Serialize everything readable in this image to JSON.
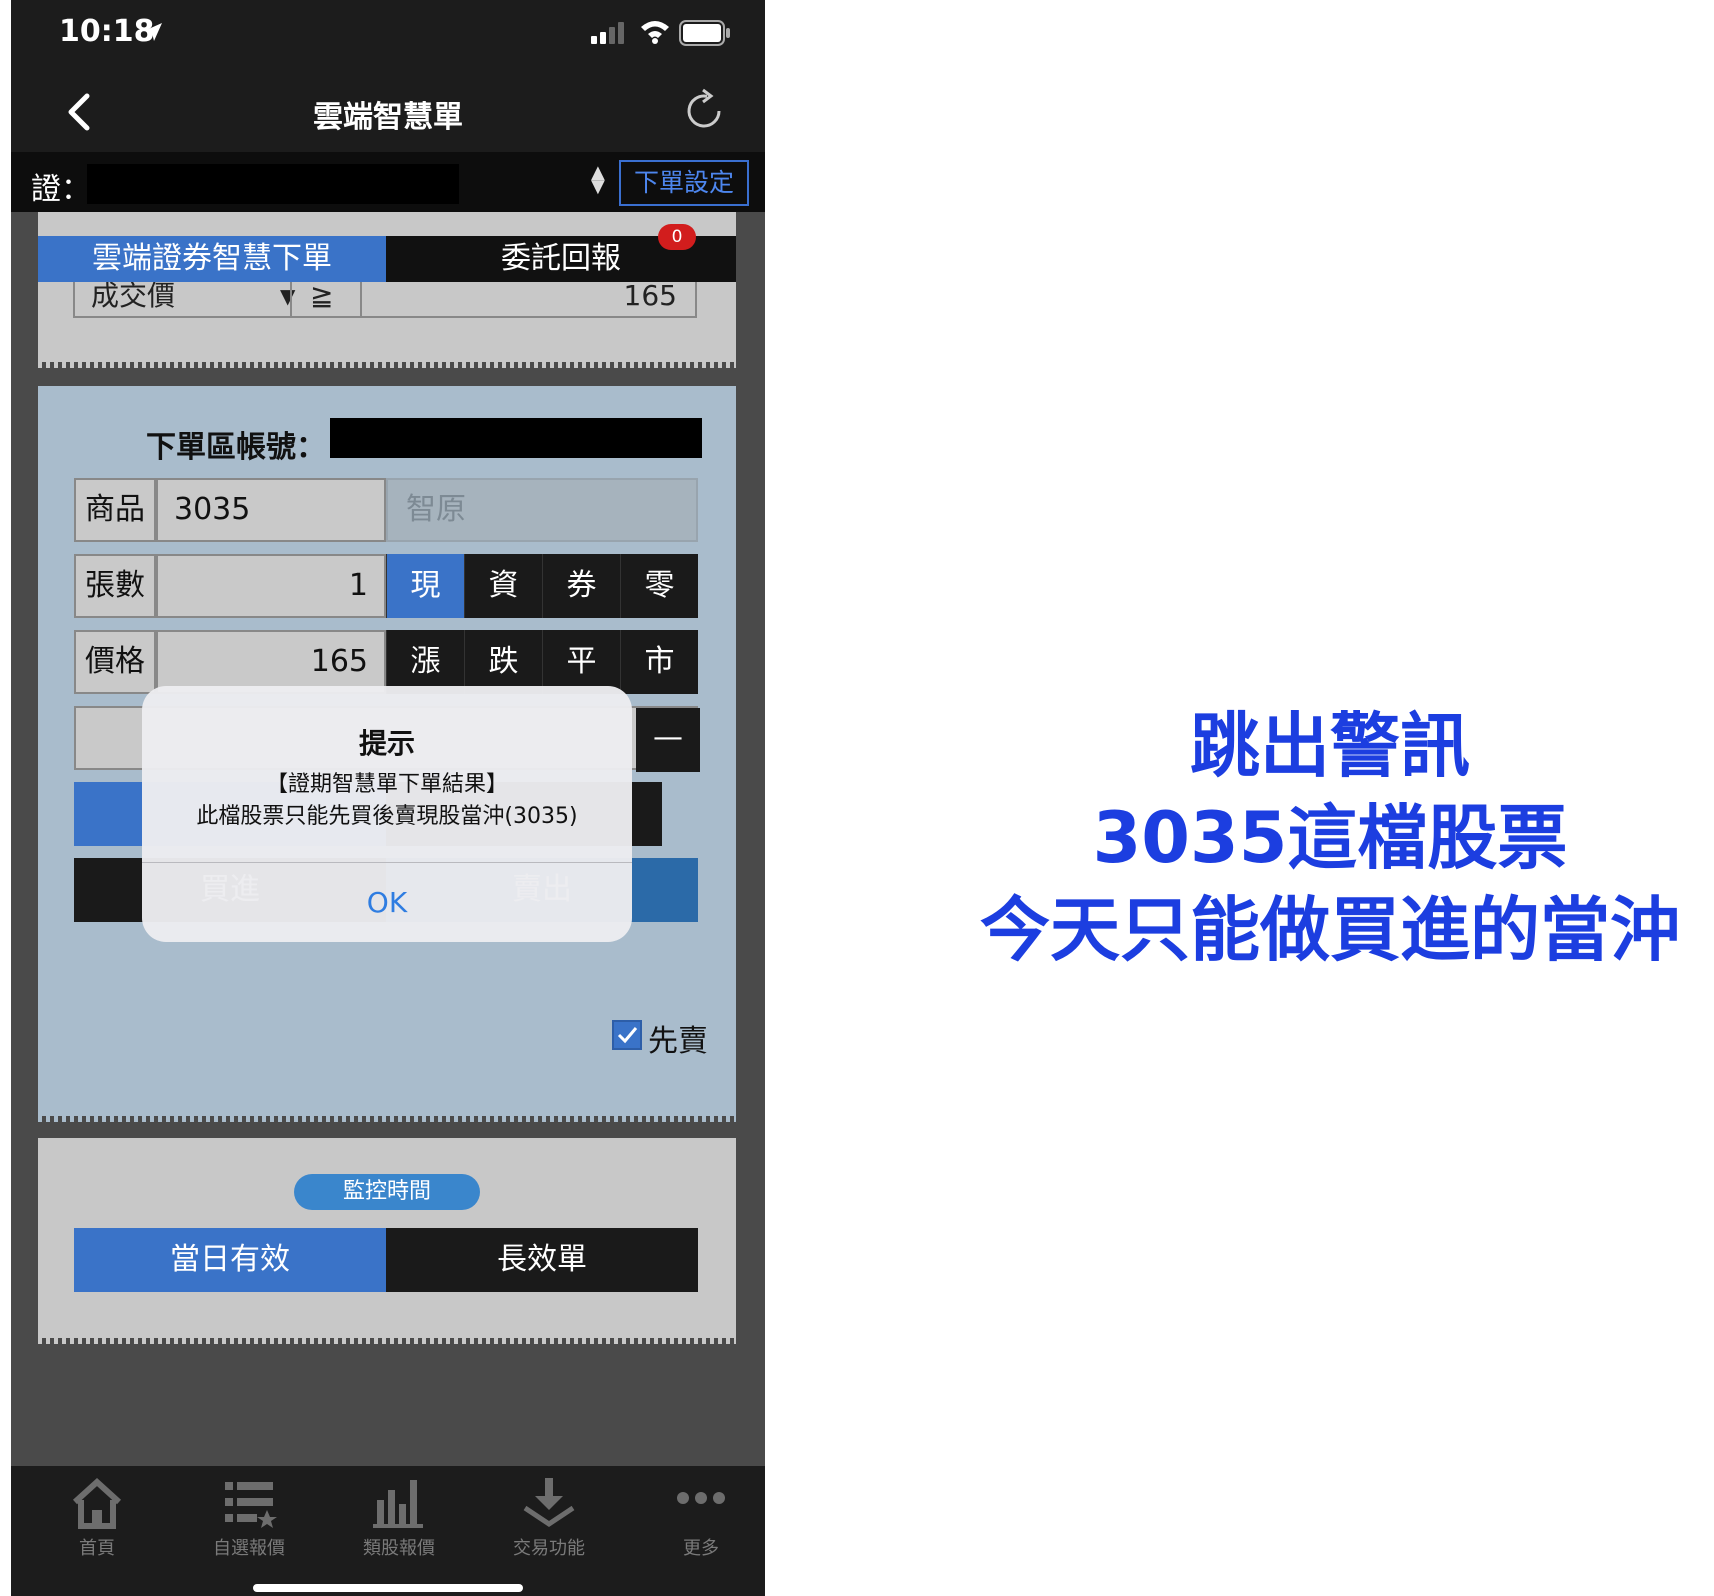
{
  "status_bar": {
    "time": "10:18"
  },
  "nav": {
    "title": "雲端智慧單"
  },
  "account_bar": {
    "label": "證：",
    "settings_button": "下單設定"
  },
  "tabs": {
    "cloud": "雲端證券智慧下單",
    "report": "委託回報",
    "report_badge": "0"
  },
  "top_card": {
    "condition": "成交價",
    "operator": "≧",
    "value": "165"
  },
  "order": {
    "account_label": "下單區帳號：",
    "product_label": "商品",
    "product_code": "3035",
    "product_name": "智原",
    "qty_label": "張數",
    "qty_value": "1",
    "qty_types": [
      "現",
      "資",
      "券",
      "零"
    ],
    "price_label": "價格",
    "price_value": "165",
    "price_types": [
      "漲",
      "跌",
      "平",
      "市"
    ],
    "minus": "—",
    "buy": "買進",
    "sell": "賣出",
    "sell_first": "先賣"
  },
  "monitor": {
    "label": "監控時間",
    "day": "當日有效",
    "long": "長效單"
  },
  "tabbar": [
    "首頁",
    "自選報價",
    "類股報價",
    "交易功能",
    "更多"
  ],
  "alert": {
    "title": "提示",
    "line1": "【證期智慧單下單結果】",
    "line2": "此檔股票只能先買後賣現股當沖(3035)",
    "ok": "OK"
  },
  "annotation": [
    "跳出警訊",
    "3035這檔股票",
    "今天只能做買進的當沖"
  ],
  "colors": {
    "accent_blue": "#3a73c8",
    "annotation": "#1c3ee0",
    "badge_red": "#d21d1d"
  }
}
